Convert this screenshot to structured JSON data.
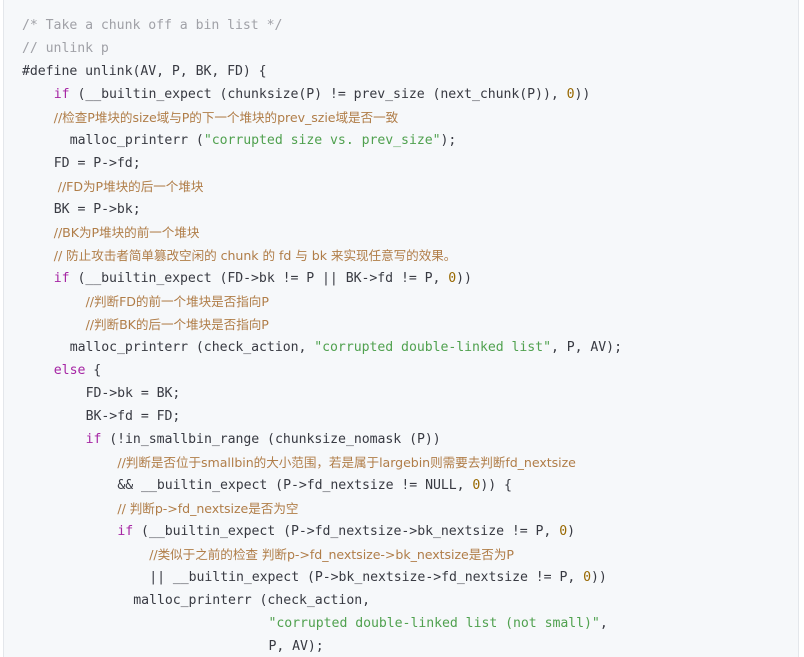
{
  "colors": {
    "background": "#f6f8fa",
    "text": "#383a42",
    "comment": "#a0a1a7",
    "chinese_comment": "#b07d48",
    "keyword": "#a626a4",
    "string": "#50a14f",
    "number": "#986801"
  },
  "code": {
    "lines": [
      {
        "indent": 0,
        "tokens": [
          {
            "t": "comment",
            "v": "/* Take a chunk off a bin list */"
          }
        ]
      },
      {
        "indent": 0,
        "tokens": [
          {
            "t": "comment",
            "v": "// unlink p"
          }
        ]
      },
      {
        "indent": 0,
        "tokens": [
          {
            "t": "pre",
            "v": "#define unlink(AV, P, BK, FD) {"
          }
        ]
      },
      {
        "indent": 4,
        "tokens": [
          {
            "t": "kw",
            "v": "if"
          },
          {
            "t": "plain",
            "v": " (__builtin_expect (chunksize(P) != prev_size (next_chunk(P)), "
          },
          {
            "t": "num",
            "v": "0"
          },
          {
            "t": "plain",
            "v": "))"
          }
        ]
      },
      {
        "indent": 4,
        "tokens": [
          {
            "t": "zh",
            "v": "//检查P堆块的size域与P的下一个堆块的prev_szie域是否一致"
          }
        ]
      },
      {
        "indent": 6,
        "tokens": [
          {
            "t": "plain",
            "v": "malloc_printerr ("
          },
          {
            "t": "str",
            "v": "\"corrupted size vs. prev_size\""
          },
          {
            "t": "plain",
            "v": ");"
          }
        ]
      },
      {
        "indent": 4,
        "tokens": [
          {
            "t": "plain",
            "v": "FD = P->fd;"
          }
        ]
      },
      {
        "indent": 4,
        "tokens": [
          {
            "t": "zh",
            "v": " //FD为P堆块的后一个堆块"
          }
        ]
      },
      {
        "indent": 4,
        "tokens": [
          {
            "t": "plain",
            "v": "BK = P->bk;"
          }
        ]
      },
      {
        "indent": 4,
        "tokens": [
          {
            "t": "zh",
            "v": "//BK为P堆块的前一个堆块"
          }
        ]
      },
      {
        "indent": 4,
        "tokens": [
          {
            "t": "zh",
            "v": "// 防止攻击者简单篡改空闲的 chunk 的 fd 与 bk 来实现任意写的效果。"
          }
        ]
      },
      {
        "indent": 4,
        "tokens": [
          {
            "t": "kw",
            "v": "if"
          },
          {
            "t": "plain",
            "v": " (__builtin_expect (FD->bk != P || BK->fd != P, "
          },
          {
            "t": "num",
            "v": "0"
          },
          {
            "t": "plain",
            "v": "))"
          }
        ]
      },
      {
        "indent": 8,
        "tokens": [
          {
            "t": "zh",
            "v": "//判断FD的前一个堆块是否指向P"
          }
        ]
      },
      {
        "indent": 8,
        "tokens": [
          {
            "t": "zh",
            "v": "//判断BK的后一个堆块是否指向P"
          }
        ]
      },
      {
        "indent": 6,
        "tokens": [
          {
            "t": "plain",
            "v": "malloc_printerr (check_action, "
          },
          {
            "t": "str",
            "v": "\"corrupted double-linked list\""
          },
          {
            "t": "plain",
            "v": ", P, AV);"
          }
        ]
      },
      {
        "indent": 4,
        "tokens": [
          {
            "t": "kw",
            "v": "else"
          },
          {
            "t": "plain",
            "v": " {"
          }
        ]
      },
      {
        "indent": 8,
        "tokens": [
          {
            "t": "plain",
            "v": "FD->bk = BK;"
          }
        ]
      },
      {
        "indent": 8,
        "tokens": [
          {
            "t": "plain",
            "v": "BK->fd = FD;"
          }
        ]
      },
      {
        "indent": 8,
        "tokens": [
          {
            "t": "kw",
            "v": "if"
          },
          {
            "t": "plain",
            "v": " (!in_smallbin_range (chunksize_nomask (P))"
          }
        ]
      },
      {
        "indent": 12,
        "tokens": [
          {
            "t": "zh",
            "v": "//判断是否位于smallbin的大小范围，若是属于largebin则需要去判断fd_nextsize"
          }
        ]
      },
      {
        "indent": 12,
        "tokens": [
          {
            "t": "plain",
            "v": "&& __builtin_expect (P->fd_nextsize != NULL, "
          },
          {
            "t": "num",
            "v": "0"
          },
          {
            "t": "plain",
            "v": ")) {"
          }
        ]
      },
      {
        "indent": 12,
        "tokens": [
          {
            "t": "zh",
            "v": "// 判断p->fd_nextsize是否为空"
          }
        ]
      },
      {
        "indent": 12,
        "tokens": [
          {
            "t": "kw",
            "v": "if"
          },
          {
            "t": "plain",
            "v": " (__builtin_expect (P->fd_nextsize->bk_nextsize != P, "
          },
          {
            "t": "num",
            "v": "0"
          },
          {
            "t": "plain",
            "v": ")"
          }
        ]
      },
      {
        "indent": 16,
        "tokens": [
          {
            "t": "zh",
            "v": "//类似于之前的检查 判断p->fd_nextsize->bk_nextsize是否为P"
          }
        ]
      },
      {
        "indent": 16,
        "tokens": [
          {
            "t": "plain",
            "v": "|| __builtin_expect (P->bk_nextsize->fd_nextsize != P, "
          },
          {
            "t": "num",
            "v": "0"
          },
          {
            "t": "plain",
            "v": "))"
          }
        ]
      },
      {
        "indent": 14,
        "tokens": [
          {
            "t": "plain",
            "v": "malloc_printerr (check_action,"
          }
        ]
      },
      {
        "indent": 31,
        "tokens": [
          {
            "t": "str",
            "v": "\"corrupted double-linked list (not small)\""
          },
          {
            "t": "plain",
            "v": ","
          }
        ]
      },
      {
        "indent": 31,
        "tokens": [
          {
            "t": "plain",
            "v": "P, AV);"
          }
        ]
      }
    ]
  }
}
